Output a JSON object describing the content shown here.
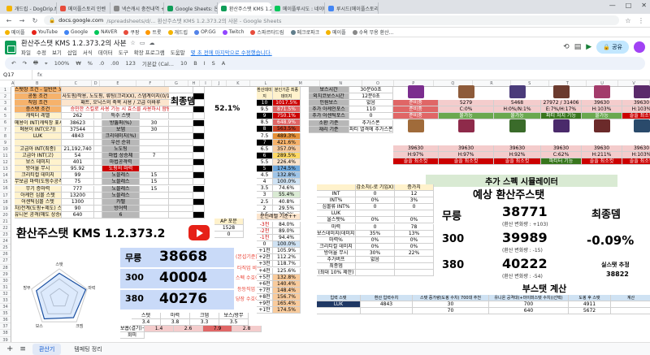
{
  "browser": {
    "tabs": [
      {
        "label": "개드립 - DogDrip.Net 개드립",
        "color": "#f4b400"
      },
      {
        "label": "메이플스토리 인벤",
        "color": "#e74c3c"
      },
      {
        "label": "넥슨캐시 충전내역 + 넥슨캐시",
        "color": "#888888"
      },
      {
        "label": "Google Sheets: 온라인 스프레드",
        "color": "#0f9d58"
      },
      {
        "label": "환산주스탯 KMS 1.2.373.2의",
        "color": "#0f9d58"
      },
      {
        "label": "메이플루시도 : 네이버 통합검색",
        "color": "#03c75a"
      },
      {
        "label": "루시드(메이플스토리)/보스 패턴",
        "color": "#4285f4"
      }
    ],
    "active_tab": 4,
    "url_domain": "docs.google.com",
    "url_rest": "/spreadsheets/d/... 환산주스탯 KMS 1.2.373.2의 사본 - Google Sheets",
    "bookmarks": [
      {
        "label": "메이플",
        "color": "#f4b400"
      },
      {
        "label": "YouTube",
        "color": "#e62117"
      },
      {
        "label": "Google",
        "color": "#4285f4"
      },
      {
        "label": "NAVER",
        "color": "#03c75a"
      },
      {
        "label": "쿠팡",
        "color": "#e74c3c"
      },
      {
        "label": "트롯",
        "color": "#ff9800"
      },
      {
        "label": "개드립",
        "color": "#f4b400"
      },
      {
        "label": "OP.GG",
        "color": "#5383e8"
      },
      {
        "label": "Twitch",
        "color": "#9146ff"
      },
      {
        "label": "스파르타드림",
        "color": "#e74c3c"
      },
      {
        "label": "메크로파크",
        "color": "#607d8b"
      },
      {
        "label": "메이플",
        "color": "#f4b400"
      },
      {
        "label": "수욕 무용 환산...",
        "color": "#888888"
      }
    ],
    "window_controls": [
      "—",
      "□",
      "✕"
    ]
  },
  "sheets": {
    "title": "환산주스탯 KMS 1.2.373.2의 사본",
    "menu": [
      "파일",
      "수정",
      "보기",
      "삽입",
      "서식",
      "데이터",
      "도구",
      "확장 프로그램",
      "도움말"
    ],
    "last_edit": "몇 초 전에 마지막으로 수정했습니다.",
    "share_label": "공유",
    "toolbar": [
      "↶",
      "↷",
      "🖶",
      "⌖",
      "100%",
      "₩",
      "%",
      ".0",
      ".00",
      "123",
      "기본값 (Cal...",
      "10",
      "B",
      "I",
      "S",
      "A"
    ],
    "cell_ref": "Q17",
    "fx": "fx",
    "columns": [
      "A",
      "B",
      "C",
      "D",
      "E",
      "F",
      "G",
      "H",
      "I",
      "J",
      "K",
      "L",
      "M",
      "N",
      "O",
      "P",
      "Q",
      "R",
      "S",
      "T",
      "U",
      "V"
    ],
    "sheet_tabs": [
      "환산기",
      "템페팅 정리"
    ],
    "active_sheet": 0
  },
  "left": {
    "rows": [
      [
        "스탯창 조건 - 일반은 노도핑 증폭한 선택한 도핑주가스탯",
        "",
        "",
        "",
        "",
        ""
      ],
      [
        "공통 조건",
        "사도핑/작용, 노도핑, 류팅(크리XX), 스뎀계이지(0/1000",
        "",
        "",
        "",
        ""
      ],
      [
        "직업 조건",
        "패트, 오닉스의 축복 사용 / 고급 아바루",
        "",
        "",
        "",
        ""
      ],
      [
        "증스탯 조건",
        "승민한 스킬로 사용 기능 시 효스를 사용하시 함탐",
        "",
        "",
        "",
        ""
      ],
      [
        "캐릭터 레벨",
        "262",
        "",
        "특수 스탯",
        "",
        ""
      ],
      [
        "메용이 INT(캐릭창 표시)",
        "38623",
        "",
        "방뚫퍼(%)",
        "30",
        ""
      ],
      [
        "메용이 INT(오기)",
        "37544",
        "",
        "보뎀",
        "30",
        ""
      ],
      [
        "LUK",
        "4843",
        "",
        "크리데미지(%)",
        "",
        ""
      ],
      [
        "",
        "",
        "",
        "우선 순위",
        "",
        ""
      ],
      [
        "고급아 INT(최종)",
        "21,192,740",
        "",
        "노도팅",
        "",
        ""
      ],
      [
        "고급아 INT(고)",
        "54",
        "",
        "마법 상승체",
        "7",
        ""
      ],
      [
        "보스 데미지",
        "401",
        "",
        "마법공격력",
        "",
        ""
      ],
      [
        "방어율 무시",
        "95.92",
        "",
        "도핑의 마력",
        "",
        ""
      ],
      [
        "크리티컬 데미지",
        "99",
        "",
        "노블레스",
        "15",
        ""
      ],
      [
        "무보급 마력(도핑수공격)",
        "75",
        "",
        "노블레스",
        "15",
        ""
      ],
      [
        "무기 증마력",
        "777",
        "",
        "노블레스",
        "15",
        ""
      ],
      [
        "아케인 심볼 스텟",
        "13200",
        "",
        "노블레스",
        "",
        ""
      ],
      [
        "어센틱심볼 스텟",
        "1300",
        "",
        "카펠",
        "",
        ""
      ],
      [
        "차)전계(도핑+제도) 스텟",
        "90",
        "",
        "방어력",
        "",
        ""
      ],
      [
        "유니온 공격(매도 상승(시)",
        "640",
        "",
        "6",
        "",
        ""
      ]
    ],
    "banner_title": "환산주스탯 KMS 1.2.373.2",
    "ap_label": "AP 포문",
    "ap_value": "1528",
    "ap_pct": "0",
    "stats": [
      {
        "label": "무릉",
        "value": "38668",
        "note": "(본섭기준)",
        "color": "#ea4335"
      },
      {
        "label": "300",
        "value": "40004",
        "note": "스펙 수호이",
        "color": "#ea4335"
      },
      {
        "label": "380",
        "value": "40276",
        "note": "당장 수호이",
        "color": "#ea4335"
      }
    ],
    "notes": [
      "타직업 비교",
      "등등직업 비교"
    ],
    "summary_headers": [
      "스텟",
      "마력",
      "크뎀",
      "보스/방무"
    ],
    "summary_rows": [
      [
        "3.4",
        "3.8",
        "3.3",
        "3.5"
      ],
      [
        "1.4",
        "2.6",
        "7.9",
        "2.8"
      ]
    ],
    "summary_labels": [
      "보흡(결기)+마방",
      "회피"
    ],
    "final_dmg_label": "최종뎀",
    "final_dmg_value": "52.1%",
    "radar_labels": [
      "스탯",
      "마력",
      "크뎀",
      "보스",
      "방무"
    ]
  },
  "middle": {
    "header1": "환산데미지",
    "header2": "분인기준 최종데미지",
    "rows": [
      [
        "10",
        "1017.5%"
      ],
      [
        "9.5",
        "871.5%"
      ],
      [
        "9",
        "750.1%"
      ],
      [
        "8.5",
        "648.9%"
      ],
      [
        "8",
        "563.5%"
      ],
      [
        "7.5",
        "489.3%"
      ],
      [
        "7",
        "421.6%"
      ],
      [
        "6.5",
        "357.0%"
      ],
      [
        "6",
        "289.5%"
      ],
      [
        "5.5",
        "226.4%"
      ],
      [
        "5",
        "174.5%"
      ],
      [
        "4.5",
        "132.8%"
      ],
      [
        "4",
        "100.0%"
      ],
      [
        "3.5",
        "74.6%"
      ],
      [
        "3",
        "55.4%"
      ],
      [
        "2.5",
        "40.8%"
      ],
      [
        "2",
        "29.5%"
      ],
      [
        "1.5",
        "20.3%"
      ]
    ],
    "lower_header": "분인레벨 기준++",
    "lower_rows": [
      [
        "-3천",
        "84.0%"
      ],
      [
        "-2천",
        "89.0%"
      ],
      [
        "-1천",
        "94.4%"
      ],
      [
        "0",
        "100.0%"
      ],
      [
        "+1천",
        "105.9%"
      ],
      [
        "+2천",
        "112.2%"
      ],
      [
        "+3천",
        "118.7%"
      ],
      [
        "+4천",
        "125.6%"
      ],
      [
        "+5천",
        "132.8%"
      ],
      [
        "+6천",
        "140.4%"
      ],
      [
        "+7천",
        "148.4%"
      ],
      [
        "+8천",
        "156.7%"
      ],
      [
        "+9천",
        "165.4%"
      ],
      [
        "+1만",
        "174.5%"
      ]
    ]
  },
  "boss": {
    "info_rows": [
      [
        "보스시간",
        "30분00초"
      ],
      [
        "외치코보스시간",
        "12분0초"
      ],
      [
        "인원보스",
        "없음"
      ],
      [
        "추가 아케인포스",
        "110"
      ],
      [
        "추가 어센틱포스",
        "0"
      ],
      [
        "소환 기준",
        "추가스폰"
      ],
      [
        "재리 기준",
        "파티 열격에 추가스폰합 재정"
      ]
    ],
    "rows": [
      {
        "cells": [
          {
            "t": "준비중",
            "bg": "#e06666"
          },
          {
            "t": "5279",
            "bg": "#f4cccc"
          },
          {
            "t": "5468",
            "bg": "#f4cccc"
          },
          {
            "t": "27972 / 31406",
            "bg": "#f4cccc"
          },
          {
            "t": "39630",
            "bg": "#f4cccc"
          },
          {
            "t": "39630",
            "bg": "#f4cccc"
          }
        ]
      },
      {
        "cells": [
          {
            "t": "준비중",
            "bg": "#e06666"
          },
          {
            "t": "C:0%",
            "bg": "#f4cccc"
          },
          {
            "t": "H:0%/N:1%",
            "bg": "#f4cccc"
          },
          {
            "t": "E:7%/H:17%",
            "bg": "#f4cccc"
          },
          {
            "t": "H:103%",
            "bg": "#f4cccc"
          },
          {
            "t": "H:103%",
            "bg": "#f4cccc"
          }
        ]
      },
      {
        "cells": [
          {
            "t": "준비중",
            "bg": "#e06666"
          },
          {
            "t": "불가능",
            "bg": "#6aa84f"
          },
          {
            "t": "불가능",
            "bg": "#6aa84f"
          },
          {
            "t": "파티 처치 기능",
            "bg": "#38761d"
          },
          {
            "t": "불가능",
            "bg": "#6aa84f"
          },
          {
            "t": "솔플 최소컷",
            "bg": "#cc0000"
          }
        ]
      },
      {
        "cells": [
          {
            "t": "39630",
            "bg": "#f4cccc"
          },
          {
            "t": "39630",
            "bg": "#f4cccc"
          },
          {
            "t": "39630",
            "bg": "#f4cccc"
          },
          {
            "t": "39630",
            "bg": "#f4cccc"
          },
          {
            "t": "39630",
            "bg": "#f4cccc"
          },
          {
            "t": "39630",
            "bg": "#f4cccc"
          }
        ]
      },
      {
        "cells": [
          {
            "t": "H:97%",
            "bg": "#f4cccc"
          },
          {
            "t": "H:97%",
            "bg": "#f4cccc"
          },
          {
            "t": "H:92%",
            "bg": "#f4cccc"
          },
          {
            "t": "C:62%",
            "bg": "#f4cccc"
          },
          {
            "t": "H:211%",
            "bg": "#f4cccc"
          },
          {
            "t": "H:103%",
            "bg": "#f4cccc"
          }
        ]
      },
      {
        "cells": [
          {
            "t": "솔플 최소컷",
            "bg": "#cc0000"
          },
          {
            "t": "솔플 최소컷",
            "bg": "#cc0000"
          },
          {
            "t": "솔플 최소컷",
            "bg": "#cc0000"
          },
          {
            "t": "파티터 기능",
            "bg": "#38761d"
          },
          {
            "t": "솔플 최소컷",
            "bg": "#cc0000"
          },
          {
            "t": "솔플 최소컷",
            "bg": "#cc0000"
          }
        ]
      }
    ]
  },
  "sim": {
    "title": "추가 스펙 시뮬레이터",
    "col_headers": [
      "",
      "감소치(-로 기입X)",
      "증가치"
    ],
    "rows": [
      [
        "INT",
        "0",
        "12"
      ],
      [
        "INT%",
        "0%",
        "3%"
      ],
      [
        "심볼류 INT%",
        "0",
        "0"
      ],
      [
        "LUK",
        "",
        ""
      ],
      [
        "올스탯%",
        "0%",
        "0%"
      ],
      [
        "마력",
        "0",
        "78"
      ],
      [
        "보스데미지(데미지)",
        "35%",
        "13%"
      ],
      [
        "마력%",
        "0%",
        "0%"
      ],
      [
        "크리티컬 데미지",
        "0%",
        "0%"
      ],
      [
        "방어율 무시",
        "30%",
        "22%"
      ],
      [
        "추가버프",
        "없음",
        ""
      ],
      [
        "최종뎀",
        "",
        ""
      ],
      [
        "(최대 10% 제한)",
        "",
        ""
      ]
    ],
    "big_title": "예상 환산주스탯",
    "results": [
      {
        "label": "무릉",
        "value": "38771",
        "sub": "(환산 변화량 : +103)"
      },
      {
        "label": "300",
        "value": "39989",
        "sub": "(환산 변화량 : -15)"
      },
      {
        "label": "380",
        "value": "40222",
        "sub": "(환산 변화량 : -54)"
      }
    ],
    "final_label": "최종뎀",
    "final_value": "-0.09%",
    "practical_label": "실스탯 추정",
    "practical_value": "38822"
  },
  "subsec": {
    "title": "부스탯 계산",
    "headers": [
      "입력 스탯",
      "환산 입력수치",
      "스탯 증가량(도핑 수치) 700대 추천",
      "유니온 공격대(+마이퍼스탯 수치)(선택)",
      "도핑 후 스탯",
      "계산"
    ],
    "rows": [
      [
        "LUK",
        "4843",
        "30",
        "700",
        "4911",
        ""
      ],
      [
        "",
        "",
        "70",
        "640",
        "5672",
        ""
      ]
    ]
  }
}
